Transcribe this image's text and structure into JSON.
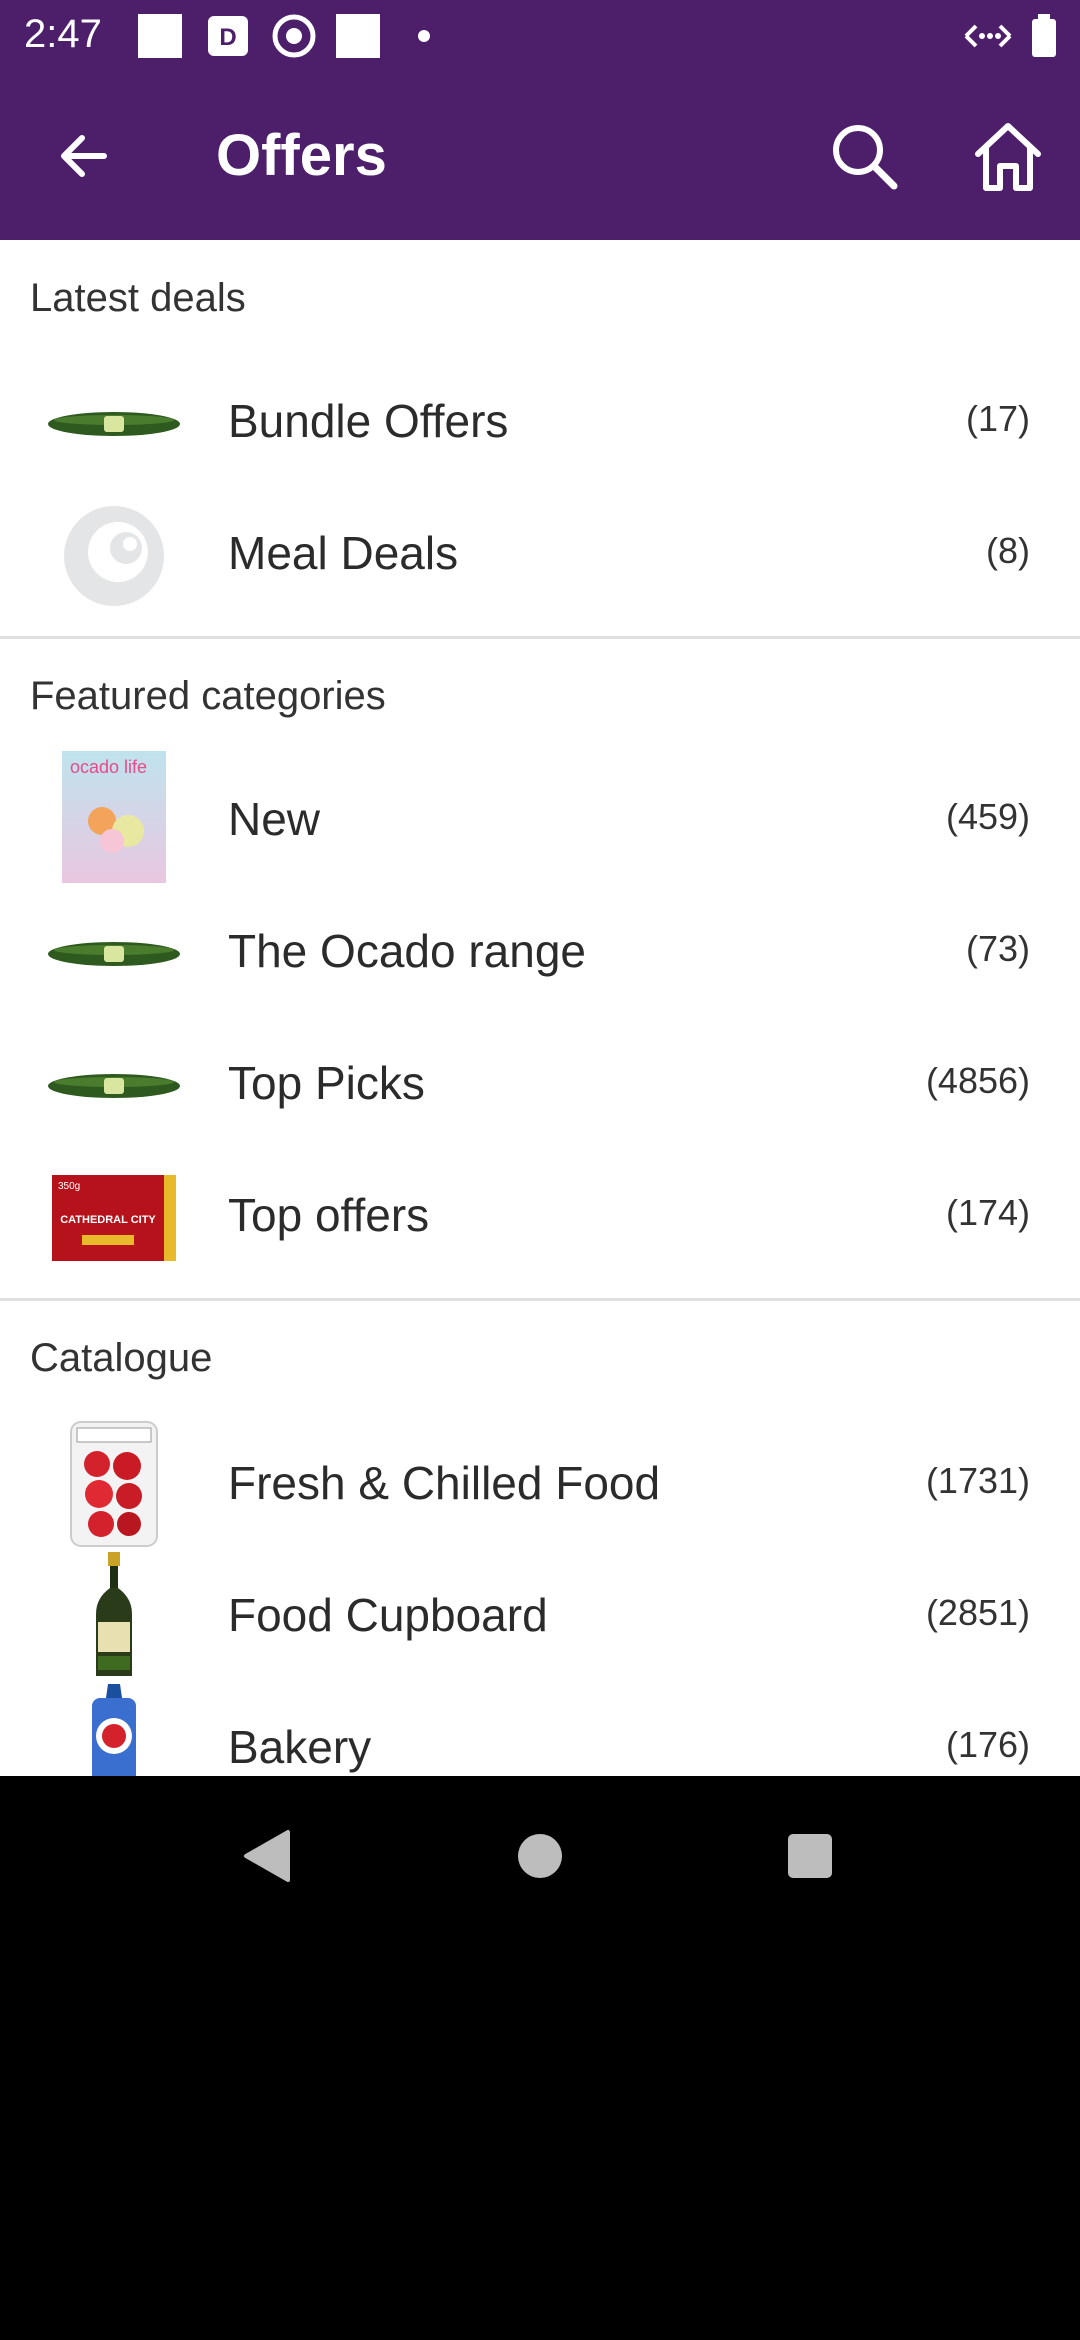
{
  "status": {
    "time": "2:47"
  },
  "appbar": {
    "title": "Offers"
  },
  "sections": {
    "latest": {
      "title": "Latest deals",
      "items": [
        {
          "label": "Bundle Offers",
          "count": "(17)"
        },
        {
          "label": "Meal Deals",
          "count": "(8)"
        }
      ]
    },
    "featured": {
      "title": "Featured categories",
      "items": [
        {
          "label": "New",
          "count": "(459)"
        },
        {
          "label": "The Ocado range",
          "count": "(73)"
        },
        {
          "label": "Top Picks",
          "count": "(4856)"
        },
        {
          "label": "Top offers",
          "count": "(174)"
        }
      ]
    },
    "catalogue": {
      "title": "Catalogue",
      "items": [
        {
          "label": "Fresh & Chilled Food",
          "count": "(1731)"
        },
        {
          "label": "Food Cupboard",
          "count": "(2851)"
        },
        {
          "label": "Bakery",
          "count": "(176)"
        }
      ]
    }
  },
  "thumb_text": {
    "ocado_magazine": "ocado life",
    "cheese_brand": "CATHEDRAL CITY",
    "cheese_weight": "350g"
  },
  "colors": {
    "brand_purple": "#4d1f6b"
  }
}
